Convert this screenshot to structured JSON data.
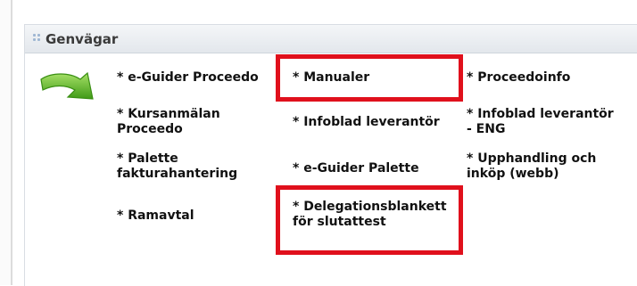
{
  "panel": {
    "title": "Genvägar",
    "icons": {
      "header": "dots-icon",
      "shortcut": "green-arrow-icon"
    }
  },
  "links": {
    "eguider_proceedo": "* e-Guider Proceedo",
    "manualer": "* Manualer",
    "proceedoinfo": "* Proceedoinfo",
    "kursanmalan_l1": "* Kursanmälan",
    "kursanmalan_l2": "Proceedo",
    "infoblad": "* Infoblad leverantör",
    "infoblad_eng_l1": "* Infoblad leverantör",
    "infoblad_eng_l2": "- ENG",
    "palette_fakt_l1": "* Palette",
    "palette_fakt_l2": "fakturahantering",
    "eguider_palette": "* e-Guider Palette",
    "upphandling_l1": "* Upphandling och",
    "upphandling_l2": "inköp (webb)",
    "ramavtal": "* Ramavtal",
    "delegation_l1": "* Delegationsblankett",
    "delegation_l2": "för slutattest"
  },
  "colors": {
    "highlight": "#e0101c",
    "arrow": "#5fb51f"
  }
}
